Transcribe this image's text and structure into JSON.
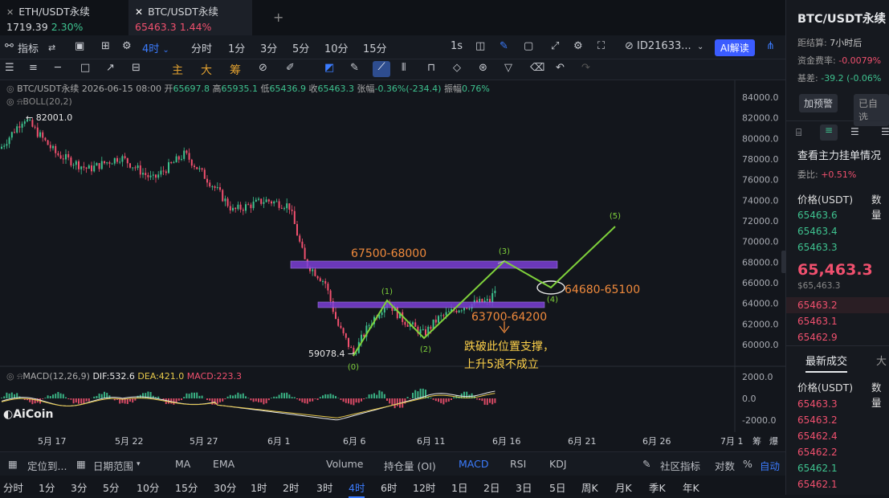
{
  "tabs": [
    {
      "label": "ETH/USDT永续",
      "price": "1719.39",
      "change": "2.30%"
    },
    {
      "label": "BTC/USDT永续",
      "price": "65463.3",
      "change": "1.44%"
    }
  ],
  "toolbar": {
    "indicator": "指标",
    "interval_active": "4时",
    "intervals": [
      "分时",
      "1分",
      "3分",
      "5分",
      "10分",
      "15分"
    ],
    "seconds": "1s",
    "account": "ID21633...",
    "ai_button": "AI解读"
  },
  "drawbar": {
    "main": "主",
    "big": "大",
    "chip": "筹"
  },
  "info": {
    "symbol": "BTC/USDT永续",
    "datetime": "2026-06-15 08:00",
    "open_label": "开",
    "open": "65697.8",
    "high_label": "高",
    "high": "65935.1",
    "low_label": "低",
    "low": "65436.9",
    "close_label": "收",
    "close": "65463.3",
    "chg_label": "张幅",
    "chg": "-0.36%(-234.4)",
    "amp_label": "振幅",
    "amp": "0.76%",
    "boll": "BOLL(20,2)"
  },
  "annotations": {
    "high_mark": "82001.0",
    "low_mark": "59078.4",
    "zone_top": "67500-68000",
    "zone_bottom": "63700-64200",
    "target": "64680-65100",
    "note_line1": "跌破此位置支撑，",
    "note_line2": "上升5浪不成立",
    "wave0": "(0)",
    "wave1": "(1)",
    "wave2": "(2)",
    "wave3": "(3)",
    "wave4": "(4)",
    "wave5": "(5)"
  },
  "price_axis": [
    "84000.0",
    "82000.0",
    "80000.0",
    "78000.0",
    "76000.0",
    "74000.0",
    "72000.0",
    "70000.0",
    "68000.0",
    "66000.0",
    "64000.0",
    "62000.0",
    "60000.0"
  ],
  "macd": {
    "label": "MACD(12,26,9)",
    "dif": "DIF:532.6",
    "dea": "DEA:421.0",
    "macd": "MACD:223.3",
    "axis": [
      "2000.0",
      "0.0",
      "-2000.0"
    ]
  },
  "watermark": "AiCoin",
  "date_axis": [
    "5月 17",
    "5月 22",
    "5月 27",
    "6月 1",
    "6月 6",
    "6月 11",
    "6月 16",
    "6月 21",
    "6月 26",
    "7月 1"
  ],
  "date_axis_right": [
    "筹",
    "爆"
  ],
  "bottom_bar": {
    "locate": "定位到...",
    "range": "日期范围",
    "indicators": [
      "MA",
      "EMA",
      "Volume",
      "持仓量 (OI)",
      "MACD",
      "RSI",
      "KDJ"
    ],
    "community": "社区指标",
    "log": "对数",
    "percent": "%",
    "auto": "自动"
  },
  "intervals_bottom": [
    "分时",
    "1分",
    "3分",
    "5分",
    "10分",
    "15分",
    "30分",
    "1时",
    "2时",
    "3时",
    "4时",
    "6时",
    "12时",
    "1日",
    "2日",
    "3日",
    "5日",
    "周K",
    "月K",
    "季K",
    "年K"
  ],
  "right": {
    "title": "BTC/USDT永续",
    "settle_label": "距结算:",
    "settle": "7小时后",
    "funding_label": "资金费率:",
    "funding": "-0.0079%",
    "basis_label": "基差:",
    "basis": "-39.2 (-0.06%",
    "alert_btn": "加预警",
    "watch_btn": "已自选",
    "orderbook_title": "查看主力挂单情况",
    "ratio_label": "委比:",
    "ratio": "+0.51%",
    "price_header": "价格(USDT)",
    "qty_header": "数量",
    "asks": [
      "65463.6",
      "65463.4",
      "65463.3"
    ],
    "last_price": "65,463.3",
    "last_sub": "$65,463.3",
    "bids": [
      "65463.2",
      "65463.1",
      "65462.9"
    ],
    "trades_title": "最新成交",
    "trades_tab2": "大",
    "trades_price_header": "价格(USDT)",
    "trades_qty_header": "数量",
    "trades": [
      "65463.3",
      "65463.2",
      "65462.4",
      "65462.2",
      "65462.1",
      "65462.1"
    ]
  },
  "colors": {
    "up": "#3ec28f",
    "down": "#f0506e",
    "accent": "#3b7cff",
    "wave": "#7fd13b",
    "zone": "#7b3fd6",
    "annot": "#f08a3c"
  }
}
